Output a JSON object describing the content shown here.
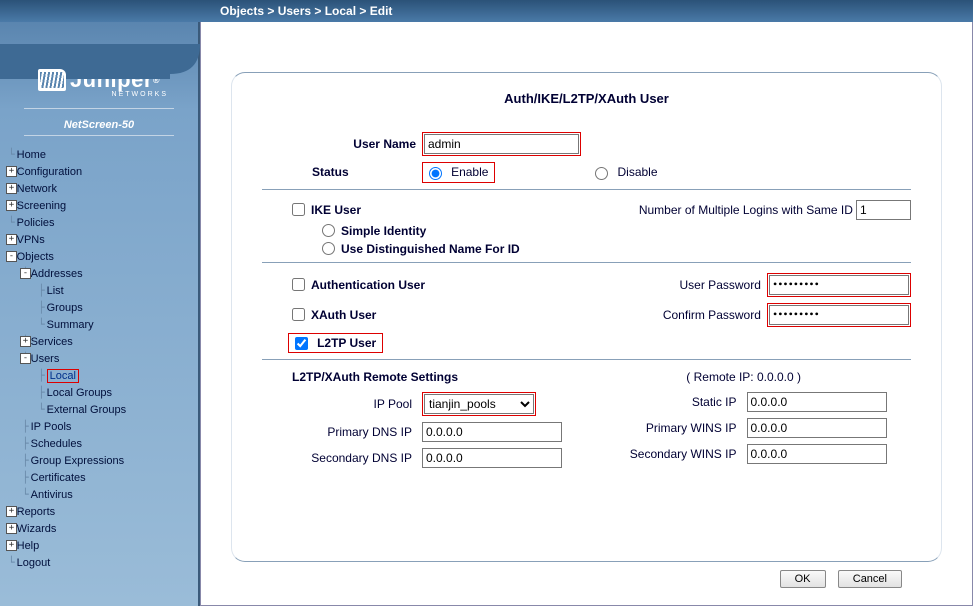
{
  "breadcrumb": "Objects > Users > Local > Edit",
  "logo": {
    "brand": "Juniper",
    "sub": "NETWORKS",
    "reg": "®"
  },
  "device": "NetScreen-50",
  "nav": {
    "home": "Home",
    "configuration": "Configuration",
    "network": "Network",
    "screening": "Screening",
    "policies": "Policies",
    "vpns": "VPNs",
    "objects": "Objects",
    "addresses": "Addresses",
    "addr_list": "List",
    "addr_groups": "Groups",
    "addr_summary": "Summary",
    "services": "Services",
    "users": "Users",
    "users_local": "Local",
    "users_local_groups": "Local Groups",
    "users_external_groups": "External Groups",
    "ip_pools": "IP Pools",
    "schedules": "Schedules",
    "group_expr": "Group Expressions",
    "certificates": "Certificates",
    "antivirus": "Antivirus",
    "reports": "Reports",
    "wizards": "Wizards",
    "help": "Help",
    "logout": "Logout"
  },
  "panel": {
    "title": "Auth/IKE/L2TP/XAuth  User",
    "user_name_label": "User Name",
    "user_name_value": "admin",
    "status_label": "Status",
    "enable_label": "Enable",
    "disable_label": "Disable",
    "status_value": "enable",
    "ike_user_label": "IKE User",
    "ike_user_checked": false,
    "multi_login_label": "Number of Multiple Logins with Same ID",
    "multi_login_value": "1",
    "simple_identity_label": "Simple Identity",
    "dn_label": "Use Distinguished Name For ID",
    "auth_user_label": "Authentication User",
    "auth_user_checked": false,
    "xauth_user_label": "XAuth User",
    "xauth_user_checked": false,
    "l2tp_user_label": "L2TP User",
    "l2tp_user_checked": true,
    "user_password_label": "User Password",
    "user_password_value": "•••••••••",
    "confirm_password_label": "Confirm Password",
    "confirm_password_value": "•••••••••",
    "remote_section": "L2TP/XAuth Remote Settings",
    "remote_ip_text": "( Remote IP: 0.0.0.0 )",
    "ip_pool_label": "IP Pool",
    "ip_pool_value": "tianjin_pools",
    "static_ip_label": "Static IP",
    "static_ip_value": "0.0.0.0",
    "primary_dns_label": "Primary DNS IP",
    "primary_dns_value": "0.0.0.0",
    "primary_wins_label": "Primary WINS IP",
    "primary_wins_value": "0.0.0.0",
    "secondary_dns_label": "Secondary DNS IP",
    "secondary_dns_value": "0.0.0.0",
    "secondary_wins_label": "Secondary WINS IP",
    "secondary_wins_value": "0.0.0.0",
    "ok": "OK",
    "cancel": "Cancel"
  }
}
